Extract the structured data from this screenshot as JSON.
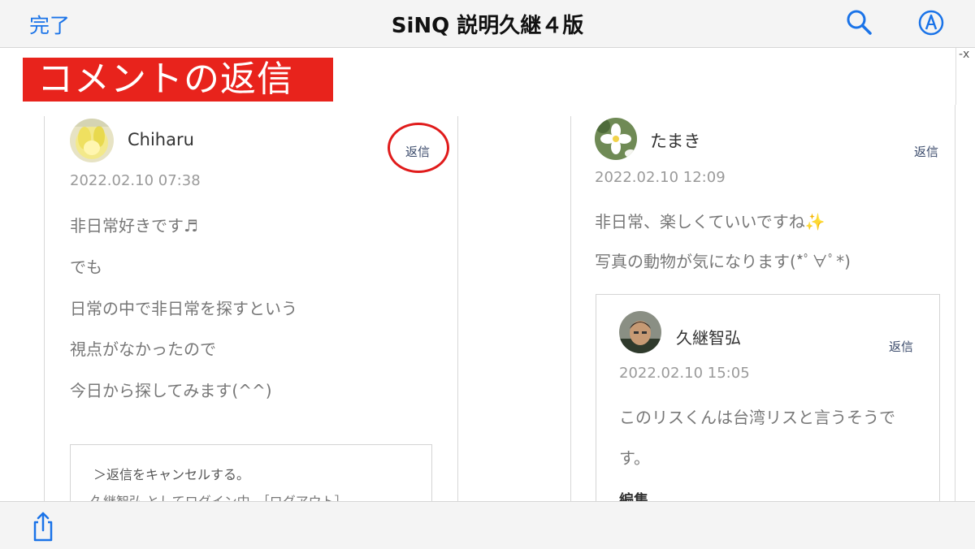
{
  "topbar": {
    "done_label": "完了",
    "title": "SiNQ 説明久継４版"
  },
  "icons": {
    "search": "search-icon",
    "markup": "markup-icon",
    "share": "share-icon"
  },
  "colors": {
    "accent": "#1a73e8",
    "banner_bg": "#e8231c",
    "highlight_circle": "#e01b1b"
  },
  "page": {
    "edge_mark": "-ⅹ",
    "banner": "コメントの返信",
    "left_comment": {
      "author": "Chiharu",
      "reply_label": "返信",
      "date": "2022.02.10 07:38",
      "lines": [
        "非日常好きです♬",
        "でも",
        "日常の中で非日常を探すという",
        "視点がなかったので",
        "今日から探してみます(^^)"
      ],
      "reply_form": {
        "cancel_link": "＞返信をキャンセルする。",
        "login_status": "久継智弘 としてログイン中。［ログアウト］"
      }
    },
    "right_comment": {
      "author": "たまき",
      "reply_label": "返信",
      "date": "2022.02.10 12:09",
      "lines": [
        "非日常、楽しくていいですね✨",
        "写真の動物が気になります(*ﾟ∀ﾟ*)"
      ],
      "nested": {
        "author": "久継智弘",
        "reply_label": "返信",
        "date": "2022.02.10 15:05",
        "lines": [
          "このリスくんは台湾リスと言うそうで",
          "す。"
        ],
        "edit_label": "編集"
      }
    }
  }
}
